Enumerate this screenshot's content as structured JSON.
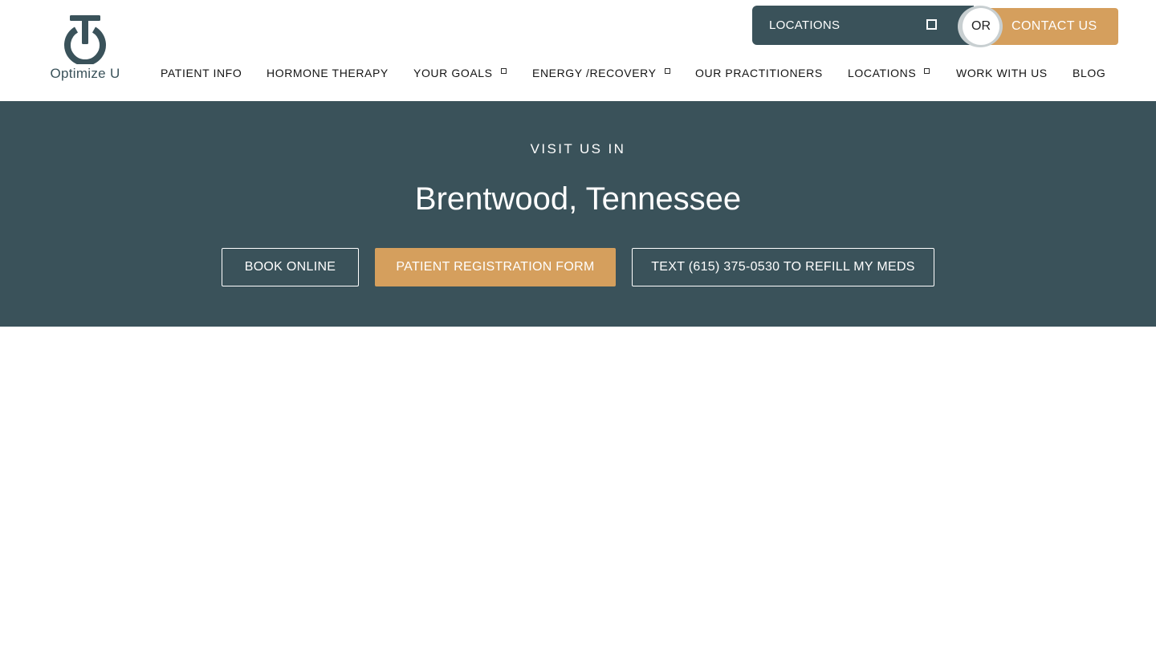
{
  "brand": {
    "name": "Optimize U",
    "primary_color": "#3a525a",
    "accent_color": "#d59f5d"
  },
  "nav": {
    "items": [
      {
        "label": "PATIENT INFO",
        "has_dropdown": false
      },
      {
        "label": "HORMONE THERAPY",
        "has_dropdown": false
      },
      {
        "label": "YOUR GOALS",
        "has_dropdown": true
      },
      {
        "label": "ENERGY /RECOVERY",
        "has_dropdown": true
      },
      {
        "label": "OUR PRACTITIONERS",
        "has_dropdown": false
      },
      {
        "label": "LOCATIONS",
        "has_dropdown": true
      },
      {
        "label": "WORK WITH US",
        "has_dropdown": false
      },
      {
        "label": "BLOG",
        "has_dropdown": false
      }
    ]
  },
  "cta_bar": {
    "locations_label": "LOCATIONS",
    "or_label": "OR",
    "contact_label": "CONTACT US"
  },
  "hero": {
    "kicker": "VISIT US IN",
    "title": "Brentwood, Tennessee",
    "buttons": {
      "book": "BOOK ONLINE",
      "registration": "PATIENT REGISTRATION FORM",
      "refill": "TEXT (615) 375-0530 TO REFILL MY MEDS"
    }
  }
}
